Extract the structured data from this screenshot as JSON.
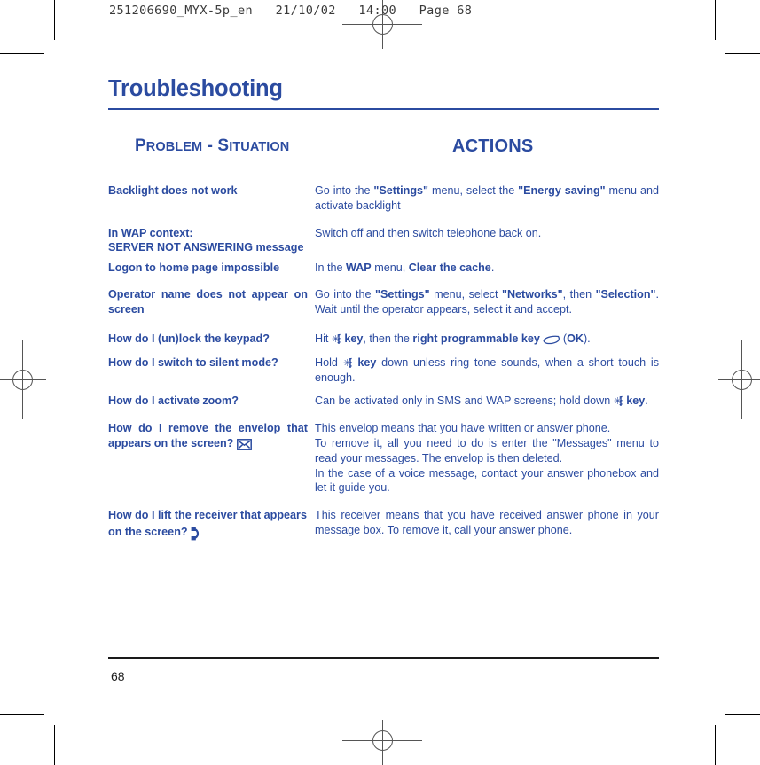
{
  "prepress": {
    "slug": "251206690_MYX-5p_en   21/10/02   14:00   Page 68"
  },
  "document": {
    "chapter_title": "Troubleshooting",
    "page_number": "68",
    "accent_color": "#2b4ba0",
    "footer_rule_color": "#1a1a1a"
  },
  "table": {
    "headers": {
      "problem": {
        "word1_cap": "P",
        "word1_rest": "ROBLEM",
        "separator": " - ",
        "word2_cap": "S",
        "word2_rest": "ITUATION"
      },
      "actions": "ACTIONS"
    },
    "rows": [
      {
        "problem_lines": [
          "Backlight does not work"
        ],
        "action_parts": [
          {
            "text": "Go into the ",
            "bold": false
          },
          {
            "text": "\"Settings\"",
            "bold": true
          },
          {
            "text": " menu, select the ",
            "bold": false
          },
          {
            "text": "\"Energy saving\"",
            "bold": true
          },
          {
            "text": " menu and activate backlight",
            "bold": false
          }
        ]
      },
      {
        "problem_lines": [
          "In WAP context:",
          "SERVER NOT ANSWERING message"
        ],
        "action_parts": [
          {
            "text": "Switch off and then switch telephone back on.",
            "bold": false
          }
        ]
      },
      {
        "problem_lines": [
          "Logon to home page impossible"
        ],
        "action_parts": [
          {
            "text": "In the ",
            "bold": false
          },
          {
            "text": "WAP",
            "bold": true
          },
          {
            "text": " menu, ",
            "bold": false
          },
          {
            "text": "Clear the cache",
            "bold": true
          },
          {
            "text": ".",
            "bold": false
          }
        ]
      },
      {
        "problem_lines": [
          "Operator name does not appear on screen"
        ],
        "justified": true,
        "action_parts": [
          {
            "text": "Go into the ",
            "bold": false
          },
          {
            "text": "\"Settings\"",
            "bold": true
          },
          {
            "text": " menu, select ",
            "bold": false
          },
          {
            "text": "\"Networks\"",
            "bold": true
          },
          {
            "text": ", then ",
            "bold": false
          },
          {
            "text": "\"Selection\"",
            "bold": true
          },
          {
            "text": ". Wait until the operator appears, select it and accept.",
            "bold": false
          }
        ]
      },
      {
        "problem_lines": [
          "How do I (un)lock the keypad?"
        ],
        "action_parts": [
          {
            "text": "Hit ",
            "bold": false
          },
          {
            "icon": "star-key-icon"
          },
          {
            "text": " key",
            "bold": true
          },
          {
            "text": ", then the ",
            "bold": false
          },
          {
            "text": "right programmable key ",
            "bold": true
          },
          {
            "icon": "soft-key-icon"
          },
          {
            "text": " (",
            "bold": false
          },
          {
            "text": "OK",
            "bold": true
          },
          {
            "text": ").",
            "bold": false
          }
        ]
      },
      {
        "problem_lines": [
          "How do I switch to silent mode?"
        ],
        "action_parts": [
          {
            "text": "Hold ",
            "bold": false
          },
          {
            "icon": "star-key-icon"
          },
          {
            "text": " key",
            "bold": true
          },
          {
            "text": " down unless ring tone sounds, when a short touch is enough.",
            "bold": false
          }
        ]
      },
      {
        "problem_lines": [
          "How do I activate zoom?"
        ],
        "action_parts": [
          {
            "text": "Can be activated only in SMS and WAP screens; hold down ",
            "bold": false
          },
          {
            "icon": "star-key-icon"
          },
          {
            "text": " key",
            "bold": true
          },
          {
            "text": ".",
            "bold": false
          }
        ]
      },
      {
        "problem_lines": [
          "How do I remove the envelop that appears on the screen?"
        ],
        "justified": true,
        "problem_icon": "envelope-icon",
        "action_parts": [
          {
            "text": "This envelop means that you have written or answer phone.",
            "bold": false
          },
          {
            "break": true
          },
          {
            "text": "To remove it, all you need to do is enter the \"Messages\" menu to read your messages. The envelop is then deleted.",
            "bold": false
          },
          {
            "break": true
          },
          {
            "text": "In the case of a voice message, contact your answer phonebox and let it guide you.",
            "bold": false
          }
        ]
      },
      {
        "problem_lines": [
          "How do I lift the receiver that appears on the screen?"
        ],
        "problem_icon": "receiver-icon",
        "action_parts": [
          {
            "text": "This receiver means that you have received answer phone in your message box. To remove it, call your answer phone.",
            "bold": false
          }
        ]
      }
    ]
  }
}
